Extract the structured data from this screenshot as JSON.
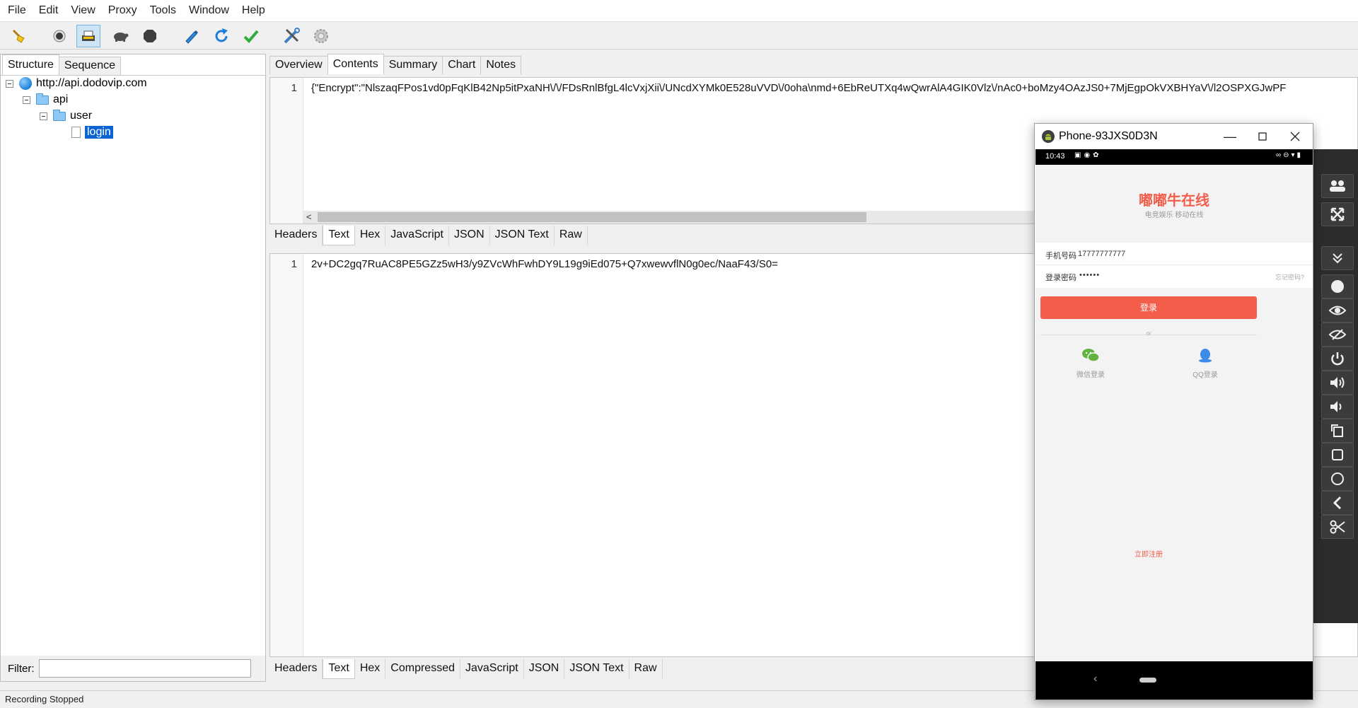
{
  "menu": [
    "File",
    "Edit",
    "View",
    "Proxy",
    "Tools",
    "Window",
    "Help"
  ],
  "toolbar": {
    "buttons": [
      "broom-icon",
      "record-icon",
      "ssl-proxy-icon",
      "throttle-icon",
      "stop-icon",
      "pen-icon",
      "refresh-icon",
      "validate-icon",
      "tools-icon",
      "settings-icon"
    ]
  },
  "left": {
    "tabs": [
      "Structure",
      "Sequence"
    ],
    "tree": {
      "host": "http://api.dodovip.com",
      "folder1": "api",
      "folder2": "user",
      "leaf": "login"
    },
    "filter_label": "Filter:",
    "filter_value": ""
  },
  "right": {
    "tabs": [
      "Overview",
      "Contents",
      "Summary",
      "Chart",
      "Notes"
    ],
    "request": {
      "line_no": "1",
      "text": "{\"Encrypt\":\"NlszaqFPos1vd0pFqKlB42Np5itPxaNH\\/\\/FDsRnlBfgL4lcVxjXii\\/UNcdXYMk0E528uVVD\\/0oha\\nmd+6EbReUTXq4wQwrAlA4GIK0Vlz\\/nAc0+boMzy4OAzJS0+7MjEgpOkVXBHYaV\\/l2OSPXGJwPF"
    },
    "request_subtabs": [
      "Headers",
      "Text",
      "Hex",
      "JavaScript",
      "JSON",
      "JSON Text",
      "Raw"
    ],
    "response": {
      "line_no": "1",
      "text": "2v+DC2gq7RuAC8PE5GZz5wH3/y9ZVcWhFwhDY9L19g9iEd075+Q7xwewvflN0g0ec/NaaF43/S0="
    },
    "response_subtabs": [
      "Headers",
      "Text",
      "Hex",
      "Compressed",
      "JavaScript",
      "JSON",
      "JSON Text",
      "Raw"
    ]
  },
  "status": "Recording Stopped",
  "phone": {
    "title": "Phone-93JXS0D3N",
    "time": "10:43",
    "app_title": "嘟嘟牛在线",
    "app_subtitle": "电竞娱乐 移动在线",
    "phone_label": "手机号码",
    "phone_value": "17777777777",
    "password_label": "登录密码",
    "password_value": "••••••",
    "forgot": "忘记密码?",
    "login_button": "登录",
    "or": "or",
    "wechat_label": "微信登录",
    "qq_label": "QQ登录",
    "register": "立即注册",
    "accent": "#f35e4a"
  },
  "side_strip": [
    "group-icon",
    "fullscreen-icon",
    "collapse-icon",
    "record-dot-icon",
    "eye-icon",
    "eye-off-icon",
    "power-icon",
    "volume-up-icon",
    "volume-down-icon",
    "rotate-icon",
    "square-icon",
    "circle-icon",
    "back-icon",
    "cut-icon"
  ]
}
